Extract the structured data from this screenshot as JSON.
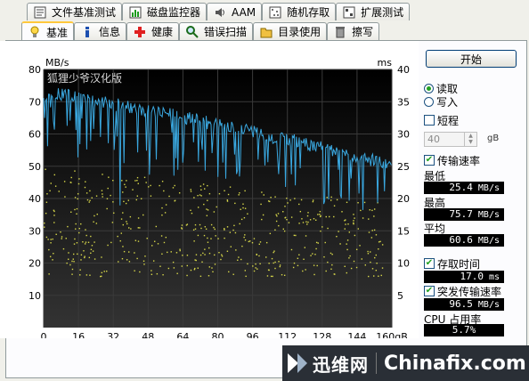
{
  "tabs_top": [
    {
      "label": "文件基准测试",
      "icon": "file-benchmark-icon"
    },
    {
      "label": "磁盘监控器",
      "icon": "disk-monitor-icon"
    },
    {
      "label": "AAM",
      "icon": "speaker-icon"
    },
    {
      "label": "随机存取",
      "icon": "random-access-icon"
    },
    {
      "label": "扩展测试",
      "icon": "extra-tests-icon"
    }
  ],
  "tabs_bottom": [
    {
      "label": "基准",
      "icon": "lightbulb-icon",
      "active": true
    },
    {
      "label": "信息",
      "icon": "info-icon"
    },
    {
      "label": "健康",
      "icon": "health-cross-icon"
    },
    {
      "label": "错误扫描",
      "icon": "magnifier-icon"
    },
    {
      "label": "目录使用",
      "icon": "folder-icon"
    },
    {
      "label": "擦写",
      "icon": "trash-icon"
    }
  ],
  "controls": {
    "start_label": "开始",
    "read_label": "读取",
    "write_label": "写入",
    "read_selected": true,
    "short_label": "短程",
    "short_checked": false,
    "size_value": "40",
    "size_unit": "gB",
    "transfer_rate_label": "传输速率",
    "transfer_rate_checked": true
  },
  "stats": {
    "min_label": "最低",
    "min_value": "25.4",
    "max_label": "最高",
    "max_value": "75.7",
    "avg_label": "平均",
    "avg_value": "60.6",
    "rate_unit": "MB/s",
    "access_label": "存取时间",
    "access_checked": true,
    "access_value": "17.0",
    "access_unit": "ms",
    "burst_label": "突发传输速率",
    "burst_checked": true,
    "burst_value": "96.5",
    "burst_unit": "MB/s",
    "cpu_label": "CPU 占用率",
    "cpu_value": "5.7%"
  },
  "watermark": {
    "cn_text": "迅维网",
    "en_text": "Chinafix.com"
  },
  "colors": {
    "transfer_line": "#3aa8e0",
    "access_dots": "#d8d84a",
    "chart_bg_top": "#000000",
    "chart_bg_bottom": "#2e2e2e",
    "grid": "#3a3a3a"
  },
  "chart_data": {
    "type": "line",
    "overlay_text": "狐狸少爷汉化版",
    "y_left_label": "MB/s",
    "y_right_label": "ms",
    "x_unit": "gB",
    "ylim_left": [
      0,
      80
    ],
    "ylim_right": [
      0,
      40
    ],
    "xlim": [
      0,
      160
    ],
    "y_left_ticks": [
      10,
      20,
      30,
      40,
      50,
      60,
      70,
      80
    ],
    "y_right_ticks": [
      5,
      10,
      15,
      20,
      25,
      30,
      35,
      40
    ],
    "x_ticks": [
      0,
      16,
      32,
      48,
      64,
      80,
      96,
      112,
      128,
      144,
      160
    ],
    "grid": true,
    "series": [
      {
        "kind": "transfer_rate",
        "axis": "left",
        "x": [
          0,
          4,
          8,
          12,
          16,
          20,
          24,
          28,
          32,
          36,
          40,
          44,
          48,
          52,
          56,
          60,
          64,
          68,
          72,
          76,
          80,
          84,
          88,
          92,
          96,
          100,
          104,
          108,
          112,
          116,
          120,
          124,
          128,
          132,
          136,
          140,
          144,
          148,
          152,
          156,
          160
        ],
        "y": [
          72,
          73,
          72,
          72,
          71,
          71,
          70,
          70,
          69,
          69,
          68,
          68,
          67,
          67,
          66,
          66,
          65,
          65,
          64,
          64,
          63,
          62,
          62,
          61,
          61,
          60,
          59,
          59,
          58,
          58,
          57,
          56,
          56,
          55,
          54,
          54,
          53,
          52,
          52,
          51,
          50
        ]
      },
      {
        "kind": "access_time",
        "axis": "right",
        "x_range": [
          0,
          160
        ],
        "y_range_ms": [
          8,
          25
        ]
      }
    ]
  }
}
